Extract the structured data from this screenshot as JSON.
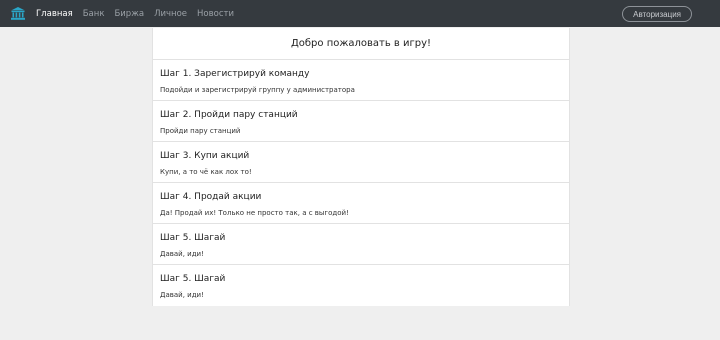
{
  "nav": {
    "brand_icon": "bank-building-icon",
    "links": [
      {
        "label": "Главная",
        "active": true
      },
      {
        "label": "Банк",
        "active": false
      },
      {
        "label": "Биржа",
        "active": false
      },
      {
        "label": "Личное",
        "active": false
      },
      {
        "label": "Новости",
        "active": false
      }
    ],
    "auth_label": "Авторизация"
  },
  "main": {
    "heading": "Добро пожаловать в игру!",
    "steps": [
      {
        "title": "Шаг 1. Зарегистрируй команду",
        "desc": "Подойди и зарегистрируй группу у администратора"
      },
      {
        "title": "Шаг 2. Пройди пару станций",
        "desc": "Пройди пару станций"
      },
      {
        "title": "Шаг 3. Купи акций",
        "desc": "Купи, а то чё как лох то!"
      },
      {
        "title": "Шаг 4. Продай акции",
        "desc": "Да! Продай их! Только не просто так, а с выгодой!"
      },
      {
        "title": "Шаг 5. Шагай",
        "desc": "Давай, иди!"
      },
      {
        "title": "Шаг 5. Шагай",
        "desc": "Давай, иди!"
      }
    ]
  },
  "colors": {
    "navbar_bg": "#353a3f",
    "brand_accent": "#2aa6c8",
    "page_bg": "#efefef"
  }
}
